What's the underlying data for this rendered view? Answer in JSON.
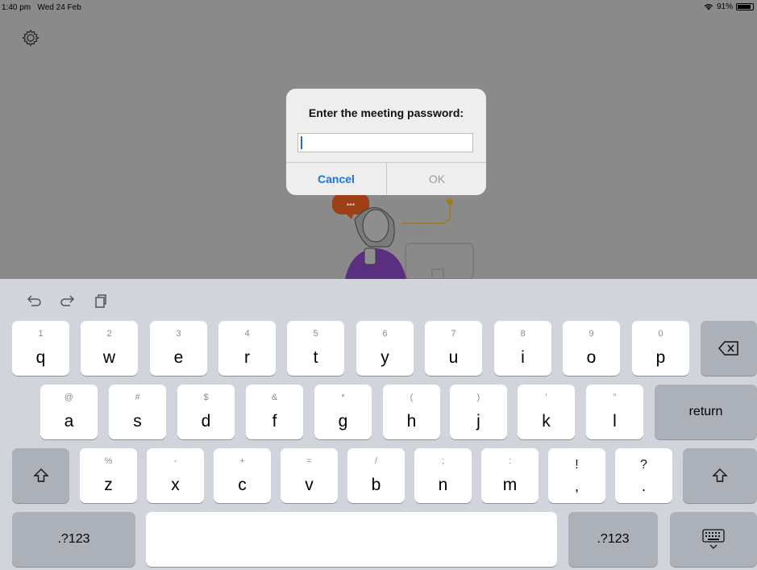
{
  "status_bar": {
    "time": "1:40 pm",
    "date": "Wed 24 Feb",
    "battery_text": "91%",
    "battery_level": 0.91
  },
  "dialog": {
    "title": "Enter the meeting password:",
    "input_value": "",
    "cancel_label": "Cancel",
    "ok_label": "OK"
  },
  "keyboard": {
    "row1": [
      {
        "sub": "1",
        "main": "q"
      },
      {
        "sub": "2",
        "main": "w"
      },
      {
        "sub": "3",
        "main": "e"
      },
      {
        "sub": "4",
        "main": "r"
      },
      {
        "sub": "5",
        "main": "t"
      },
      {
        "sub": "6",
        "main": "y"
      },
      {
        "sub": "7",
        "main": "u"
      },
      {
        "sub": "8",
        "main": "i"
      },
      {
        "sub": "9",
        "main": "o"
      },
      {
        "sub": "0",
        "main": "p"
      }
    ],
    "row2": [
      {
        "sub": "@",
        "main": "a"
      },
      {
        "sub": "#",
        "main": "s"
      },
      {
        "sub": "$",
        "main": "d"
      },
      {
        "sub": "&",
        "main": "f"
      },
      {
        "sub": "*",
        "main": "g"
      },
      {
        "sub": "(",
        "main": "h"
      },
      {
        "sub": ")",
        "main": "j"
      },
      {
        "sub": "’",
        "main": "k"
      },
      {
        "sub": "”",
        "main": "l"
      }
    ],
    "row3": [
      {
        "sub": "%",
        "main": "z"
      },
      {
        "sub": "-",
        "main": "x"
      },
      {
        "sub": "+",
        "main": "c"
      },
      {
        "sub": "=",
        "main": "v"
      },
      {
        "sub": "/",
        "main": "b"
      },
      {
        "sub": ";",
        "main": "n"
      },
      {
        "sub": ":",
        "main": "m"
      },
      {
        "sub": "!",
        "main": ","
      },
      {
        "sub": "?",
        "main": "."
      }
    ],
    "return_label": "return",
    "numbers_label": ".?123"
  }
}
